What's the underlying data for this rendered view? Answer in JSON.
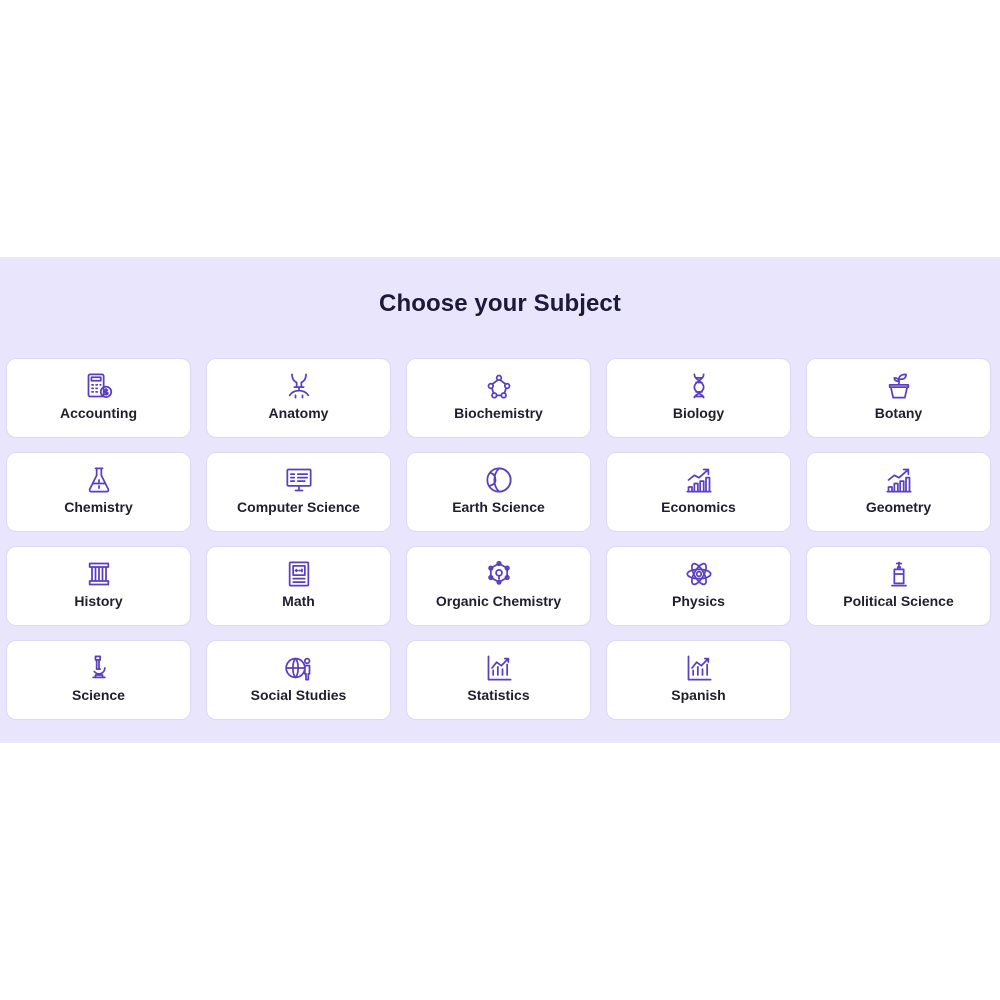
{
  "page": {
    "title": "Choose your Subject"
  },
  "colors": {
    "band_background": "#e9e5fc",
    "icon_accent": "#5a3fc0",
    "card_background": "#ffffff",
    "text": "#1f1f2e"
  },
  "subjects": [
    {
      "label": "Accounting",
      "icon": "calculator-icon"
    },
    {
      "label": "Anatomy",
      "icon": "anatomy-icon"
    },
    {
      "label": "Biochemistry",
      "icon": "molecule-icon"
    },
    {
      "label": "Biology",
      "icon": "dna-icon"
    },
    {
      "label": "Botany",
      "icon": "plant-pot-icon"
    },
    {
      "label": "Chemistry",
      "icon": "flask-icon"
    },
    {
      "label": "Computer Science",
      "icon": "monitor-icon"
    },
    {
      "label": "Earth Science",
      "icon": "globe-icon"
    },
    {
      "label": "Economics",
      "icon": "bar-chart-icon"
    },
    {
      "label": "Geometry",
      "icon": "bar-chart-icon"
    },
    {
      "label": "History",
      "icon": "column-icon"
    },
    {
      "label": "Math",
      "icon": "math-book-icon"
    },
    {
      "label": "Organic Chemistry",
      "icon": "organic-molecule-icon"
    },
    {
      "label": "Physics",
      "icon": "atom-icon"
    },
    {
      "label": "Political Science",
      "icon": "podium-icon"
    },
    {
      "label": "Science",
      "icon": "microscope-icon"
    },
    {
      "label": "Social Studies",
      "icon": "globe-person-icon"
    },
    {
      "label": "Statistics",
      "icon": "line-chart-icon"
    },
    {
      "label": "Spanish",
      "icon": "line-chart-icon"
    }
  ]
}
